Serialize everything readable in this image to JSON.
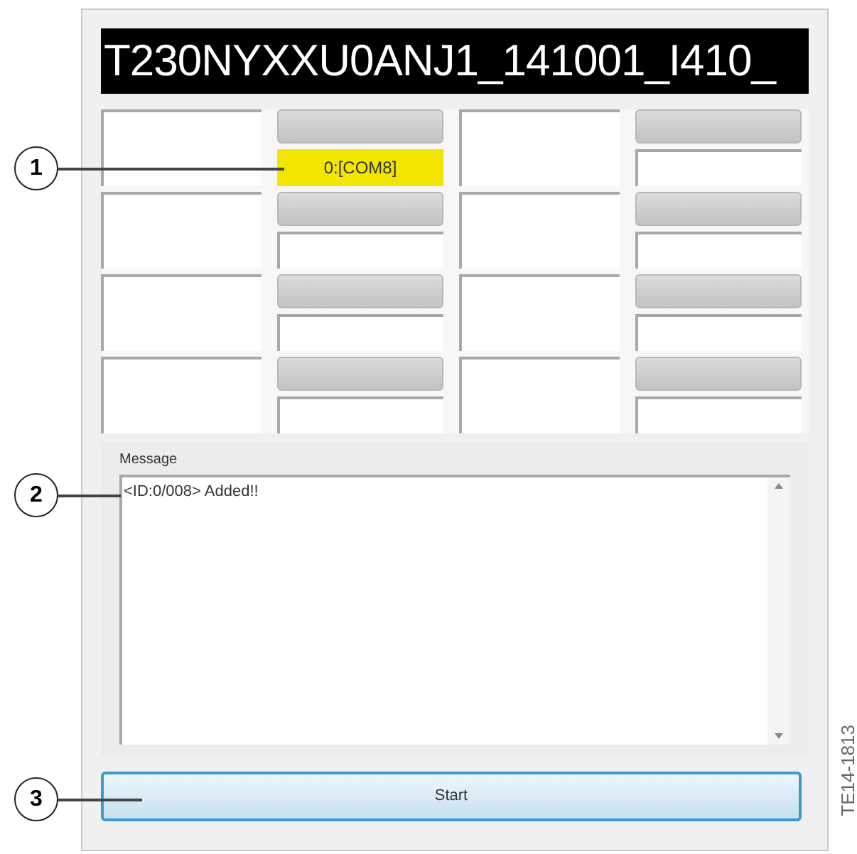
{
  "header": {
    "title": "T230NYXXU0ANJ1_141001_I410_"
  },
  "slots": [
    {
      "status": "0:[COM8]",
      "highlighted": true
    },
    {
      "highlighted": false
    },
    {
      "highlighted": false
    },
    {
      "highlighted": false
    },
    {
      "highlighted": false
    },
    {
      "highlighted": false
    },
    {
      "highlighted": false
    },
    {
      "highlighted": false
    }
  ],
  "message": {
    "label": "Message",
    "lines": [
      "<ID:0/008> Added!!"
    ]
  },
  "start_button": {
    "label": "Start"
  },
  "callouts": [
    {
      "number": "1"
    },
    {
      "number": "2"
    },
    {
      "number": "3"
    }
  ],
  "figure_code": "TE14-1813"
}
